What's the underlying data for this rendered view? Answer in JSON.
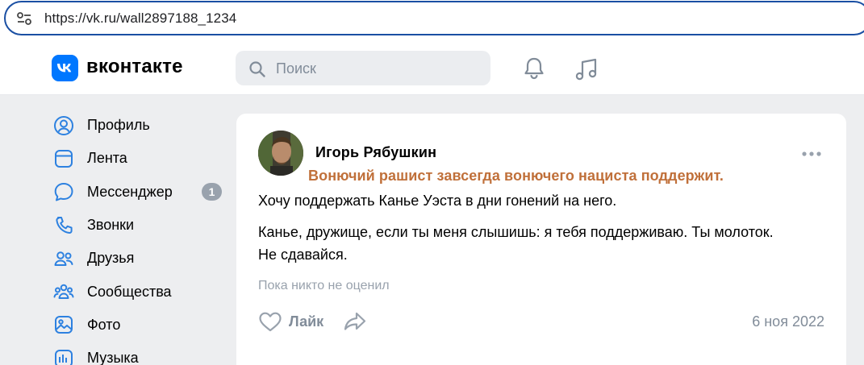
{
  "browser": {
    "url": "https://vk.ru/wall2897188_1234",
    "site_icon": "site-settings-icon"
  },
  "header": {
    "logo_icon": "vk-logo-icon",
    "logo_text": "вконтакте",
    "search_placeholder": "Поиск",
    "brand_color": "#0077ff"
  },
  "sidebar": {
    "items": [
      {
        "label": "Профиль",
        "icon": "profile-icon"
      },
      {
        "label": "Лента",
        "icon": "feed-icon"
      },
      {
        "label": "Мессенджер",
        "icon": "messenger-icon",
        "badge": "1"
      },
      {
        "label": "Звонки",
        "icon": "phone-icon"
      },
      {
        "label": "Друзья",
        "icon": "friends-icon"
      },
      {
        "label": "Сообщества",
        "icon": "communities-icon"
      },
      {
        "label": "Фото",
        "icon": "photo-icon"
      },
      {
        "label": "Музыка",
        "icon": "music-icon"
      }
    ]
  },
  "post": {
    "author": "Игорь Рябушкин",
    "annotation": "Вонючий рашист завсегда вонючего нациста поддержит.",
    "annotation_color": "#c0703a",
    "text1": "Хочу поддержать Канье Уэста в дни гонений на него.",
    "text2_line1": "Канье, дружище, если ты меня слышишь: я тебя поддерживаю. Ты молоток.",
    "text2_line2": "Не сдавайся.",
    "reactions": "Пока никто не оценил",
    "like_label": "Лайк",
    "date": "6 ноя 2022"
  }
}
